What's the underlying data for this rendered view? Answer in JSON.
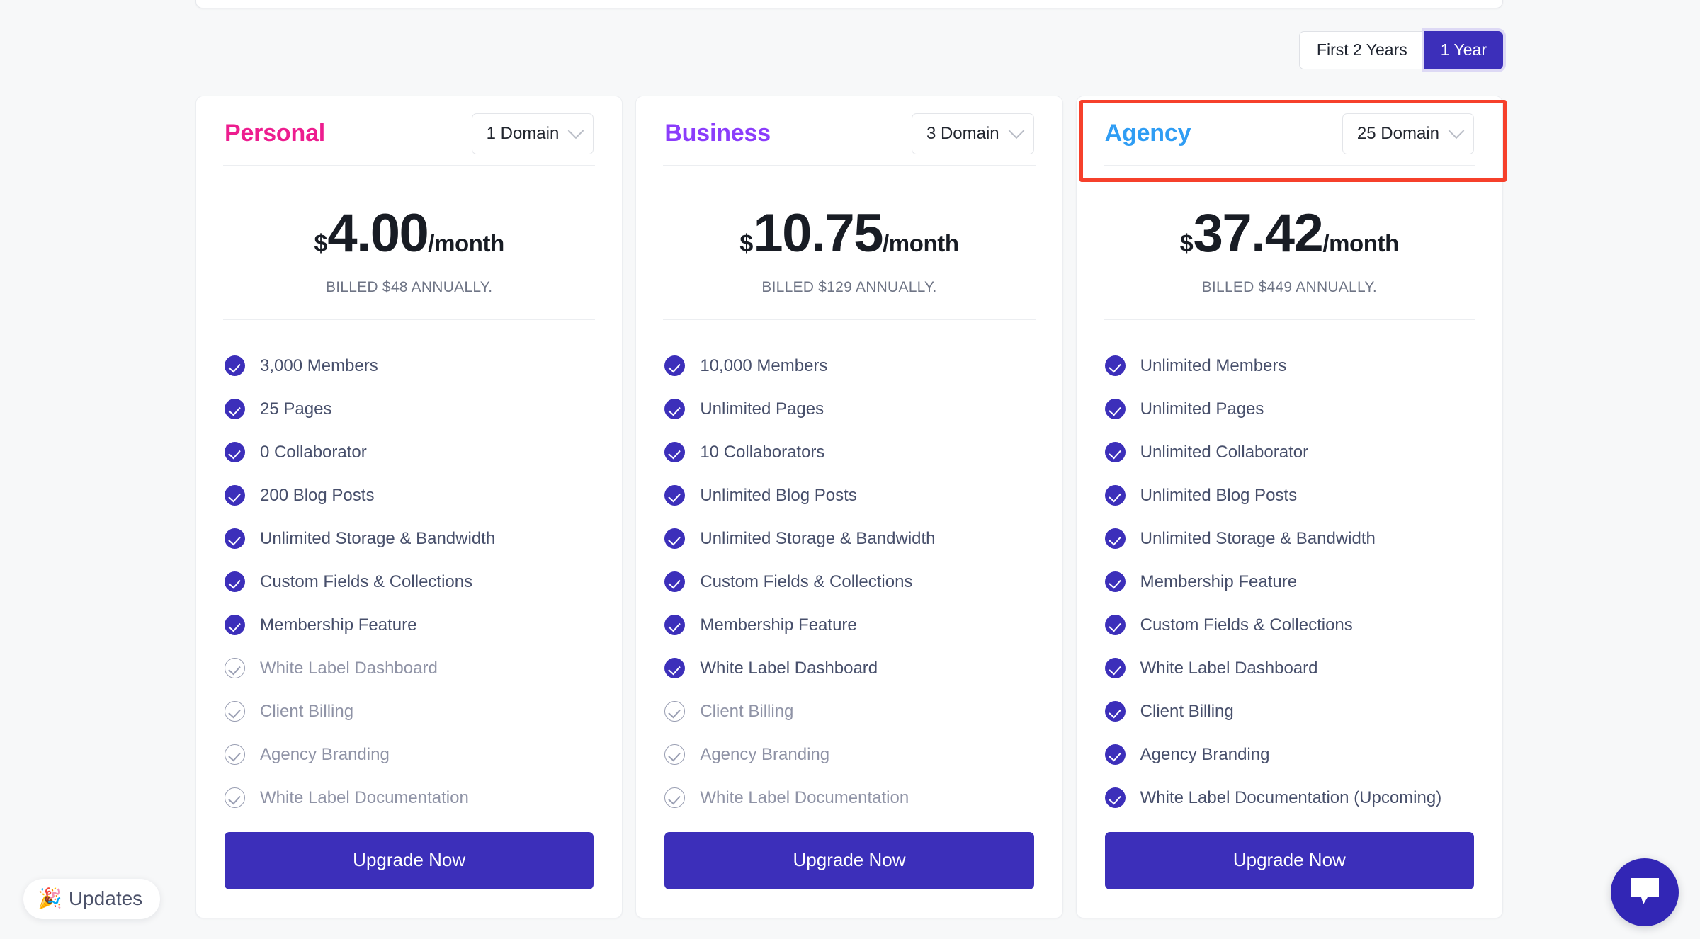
{
  "billing_toggle": {
    "options": [
      "First 2 Years",
      "1 Year"
    ],
    "first_label": "First 2 Years",
    "second_label": "1 Year",
    "selected": "1 Year"
  },
  "colors": {
    "brand_indigo": "#3c2fba",
    "personal_accent": "#ed1d8f",
    "business_accent": "#8b3dfb",
    "agency_accent": "#2f9df4",
    "highlight_box": "#f6402b",
    "page_background": "#f7f8f9"
  },
  "plans": [
    {
      "name": "Personal",
      "accent": "#ed1d8f",
      "domain_label": "1 Domain",
      "currency": "$",
      "amount": "4.00",
      "period": "/month",
      "billed": "BILLED $48 ANNUALLY.",
      "cta": "Upgrade Now",
      "highlighted": false,
      "features": [
        {
          "label": "3,000 Members",
          "included": true
        },
        {
          "label": "25 Pages",
          "included": true
        },
        {
          "label": "0 Collaborator",
          "included": true
        },
        {
          "label": "200 Blog Posts",
          "included": true
        },
        {
          "label": "Unlimited Storage & Bandwidth",
          "included": true
        },
        {
          "label": "Custom Fields & Collections",
          "included": true
        },
        {
          "label": "Membership Feature",
          "included": true
        },
        {
          "label": "White Label Dashboard",
          "included": false
        },
        {
          "label": "Client Billing",
          "included": false
        },
        {
          "label": "Agency Branding",
          "included": false
        },
        {
          "label": "White Label Documentation",
          "included": false
        }
      ]
    },
    {
      "name": "Business",
      "accent": "#8b3dfb",
      "domain_label": "3 Domain",
      "currency": "$",
      "amount": "10.75",
      "period": "/month",
      "billed": "BILLED $129 ANNUALLY.",
      "cta": "Upgrade Now",
      "highlighted": false,
      "features": [
        {
          "label": "10,000 Members",
          "included": true
        },
        {
          "label": "Unlimited Pages",
          "included": true
        },
        {
          "label": "10 Collaborators",
          "included": true
        },
        {
          "label": "Unlimited Blog Posts",
          "included": true
        },
        {
          "label": "Unlimited Storage & Bandwidth",
          "included": true
        },
        {
          "label": "Custom Fields & Collections",
          "included": true
        },
        {
          "label": "Membership Feature",
          "included": true
        },
        {
          "label": "White Label Dashboard",
          "included": true
        },
        {
          "label": "Client Billing",
          "included": false
        },
        {
          "label": "Agency Branding",
          "included": false
        },
        {
          "label": "White Label Documentation",
          "included": false
        }
      ]
    },
    {
      "name": "Agency",
      "accent": "#2f9df4",
      "domain_label": "25 Domain",
      "currency": "$",
      "amount": "37.42",
      "period": "/month",
      "billed": "BILLED $449 ANNUALLY.",
      "cta": "Upgrade Now",
      "highlighted": true,
      "features": [
        {
          "label": "Unlimited Members",
          "included": true
        },
        {
          "label": "Unlimited Pages",
          "included": true
        },
        {
          "label": "Unlimited Collaborator",
          "included": true
        },
        {
          "label": "Unlimited Blog Posts",
          "included": true
        },
        {
          "label": "Unlimited Storage & Bandwidth",
          "included": true
        },
        {
          "label": "Membership Feature",
          "included": true
        },
        {
          "label": "Custom Fields & Collections",
          "included": true
        },
        {
          "label": "White Label Dashboard",
          "included": true
        },
        {
          "label": "Client Billing",
          "included": true
        },
        {
          "label": "Agency Branding",
          "included": true
        },
        {
          "label": "White Label Documentation (Upcoming)",
          "included": true
        }
      ]
    }
  ],
  "updates_widget": {
    "label": "Updates",
    "emoji": "🎉"
  },
  "chat_widget": {
    "icon": "chat-bubble-icon"
  }
}
